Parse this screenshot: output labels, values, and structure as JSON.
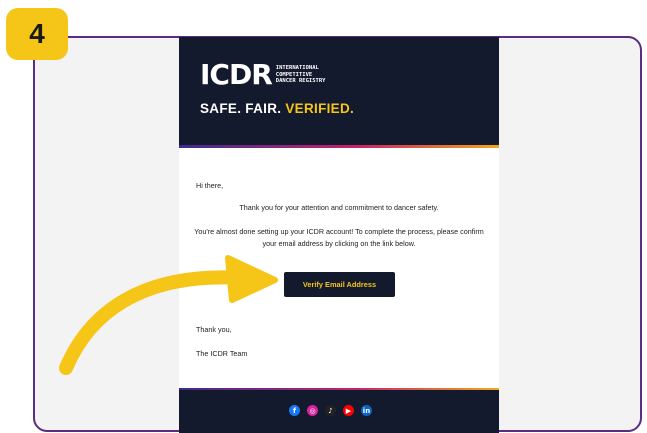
{
  "step": {
    "number": "4"
  },
  "email": {
    "logo": {
      "mark": "ICDR",
      "sub_lines": [
        "INTERNATIONAL",
        "COMPETITIVE",
        "DANCER REGISTRY"
      ]
    },
    "tagline": {
      "part1": "SAFE. FAIR. ",
      "part2": "VERIFIED."
    },
    "greeting": "Hi there,",
    "paragraph1": "Thank you for your attention and commitment to dancer safety.",
    "paragraph2": "You're almost done setting up your ICDR account! To complete the process, please confirm your email address by clicking on the link below.",
    "button_label": "Verify Email Address",
    "signoff": "Thank you,",
    "team": "The ICDR Team",
    "socials": [
      {
        "icon": "facebook-icon",
        "color": "#1877f2",
        "glyph": "f"
      },
      {
        "icon": "instagram-icon",
        "color": "#d6249f",
        "glyph": "◎"
      },
      {
        "icon": "tiktok-icon",
        "color": "#222222",
        "glyph": "♪"
      },
      {
        "icon": "youtube-icon",
        "color": "#ff0000",
        "glyph": "▶"
      },
      {
        "icon": "linkedin-icon",
        "color": "#0a66c2",
        "glyph": "in"
      }
    ]
  },
  "colors": {
    "brand_navy": "#141a2e",
    "accent_yellow": "#f5c518",
    "frame_purple": "#5b2c83"
  }
}
